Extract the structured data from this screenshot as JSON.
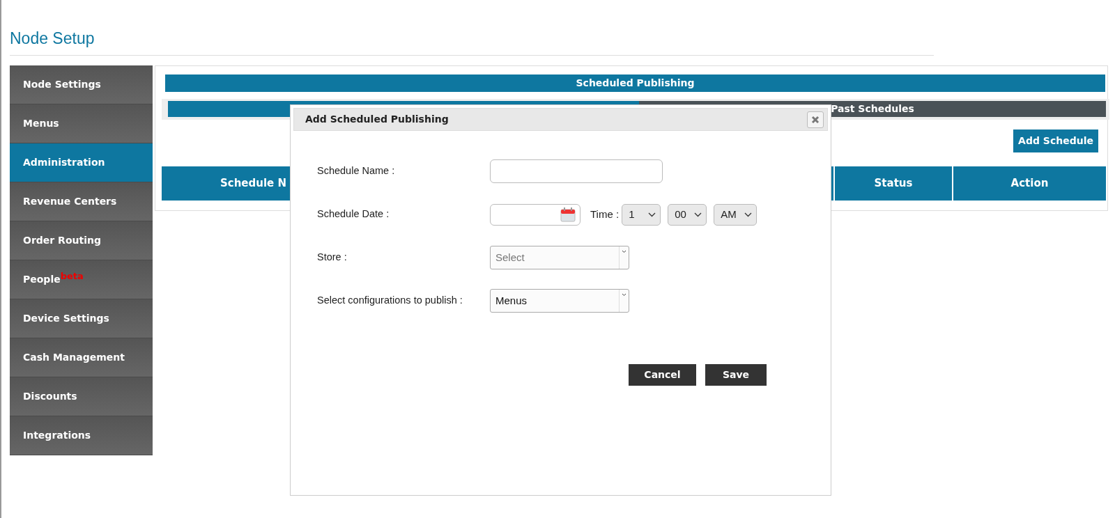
{
  "page": {
    "title": "Node Setup"
  },
  "sidebar": {
    "items": [
      {
        "label": "Node Settings",
        "selected": false
      },
      {
        "label": "Menus",
        "selected": false
      },
      {
        "label": "Administration",
        "selected": true
      },
      {
        "label": "Revenue Centers",
        "selected": false
      },
      {
        "label": "Order Routing",
        "selected": false
      },
      {
        "label": "People",
        "badge": "beta",
        "selected": false
      },
      {
        "label": "Device Settings",
        "selected": false
      },
      {
        "label": "Cash Management",
        "selected": false
      },
      {
        "label": "Discounts",
        "selected": false
      },
      {
        "label": "Integrations",
        "selected": false
      }
    ]
  },
  "panel": {
    "header": "Scheduled Publishing",
    "tabs": [
      {
        "selected": true
      },
      {
        "label": "Past Schedules",
        "selected": false
      }
    ],
    "add_button": "Add Schedule",
    "table": {
      "columns": [
        "Schedule N",
        "Status",
        "Action"
      ]
    }
  },
  "dialog": {
    "title": "Add Scheduled Publishing",
    "fields": [
      {
        "kind": "text",
        "label": "Schedule Name :"
      },
      {
        "kind": "date",
        "label": "Schedule Date :",
        "time_label": "Time :",
        "time": [
          "1",
          "00",
          "AM"
        ]
      },
      {
        "kind": "select",
        "label": "Store :",
        "placeholder": "Select"
      },
      {
        "kind": "select",
        "label": "Select configurations to publish :",
        "value": "Menus"
      }
    ],
    "buttons": [
      "Cancel",
      "Save"
    ]
  }
}
